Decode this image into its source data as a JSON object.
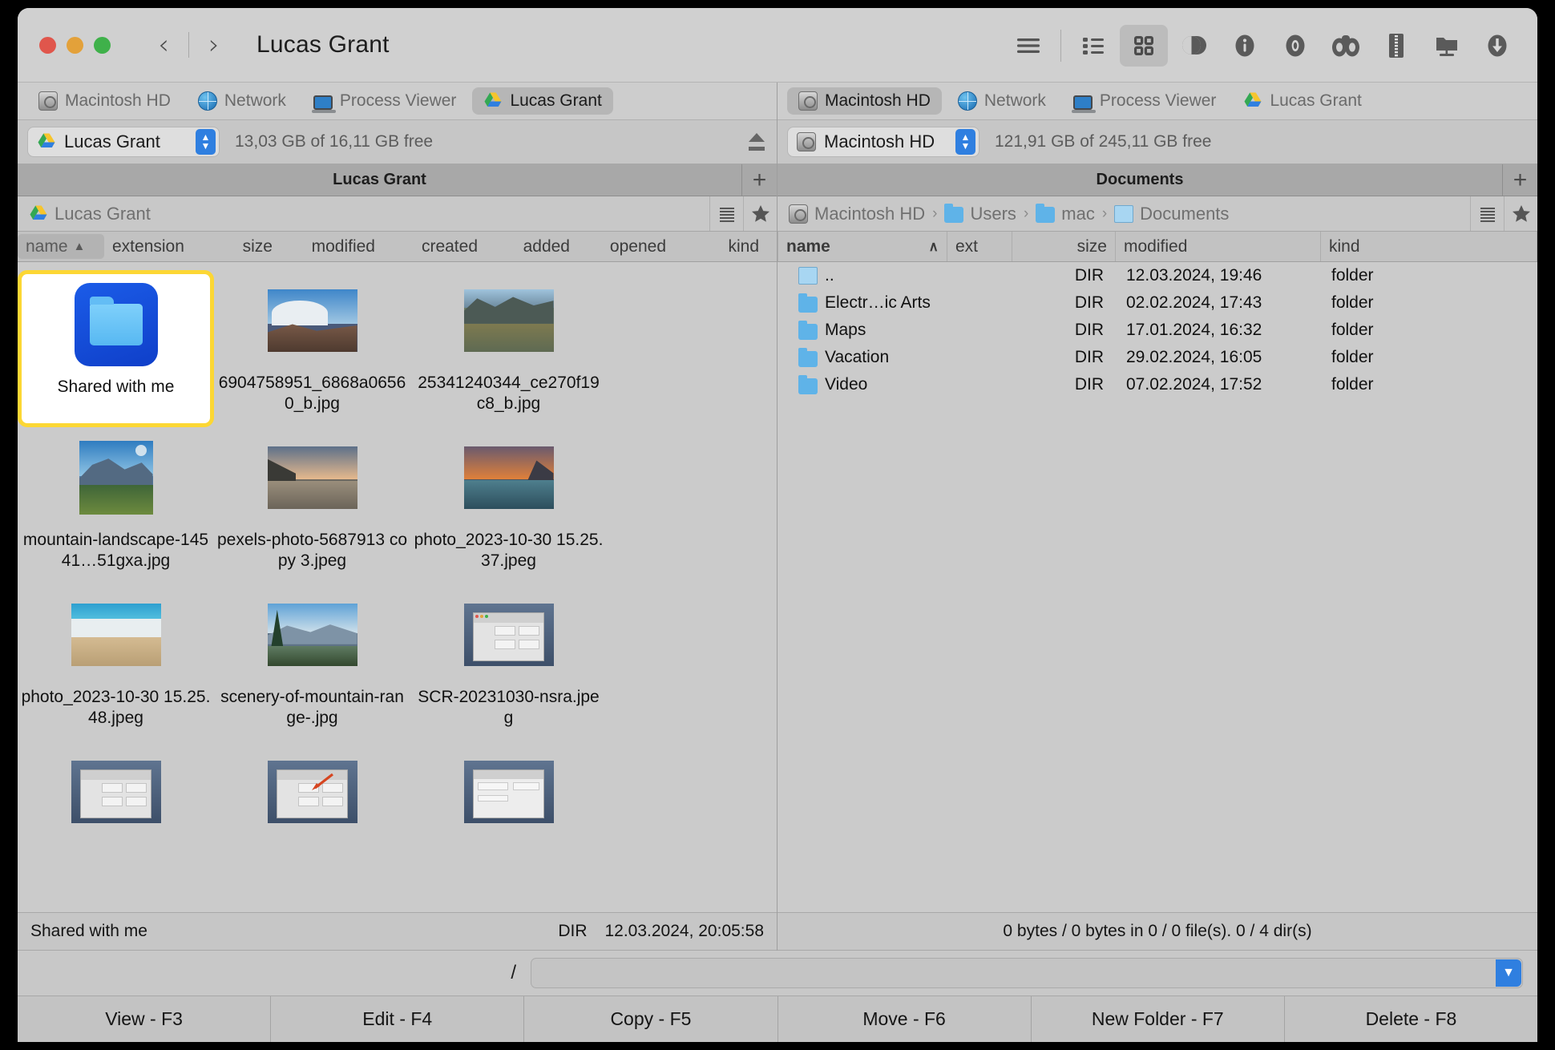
{
  "window": {
    "title": "Lucas Grant",
    "traffic": [
      "close",
      "minimize",
      "zoom"
    ],
    "nav_back": "‹",
    "nav_forward": "›"
  },
  "toolbar": {
    "items": [
      {
        "name": "menu-icon",
        "label": "Menu",
        "active": false
      },
      {
        "name": "list-view-icon",
        "label": "List View",
        "active": false
      },
      {
        "name": "grid-view-icon",
        "label": "Grid View",
        "active": true
      },
      {
        "name": "contrast-toggle-icon",
        "label": "Toggle",
        "active": false
      },
      {
        "name": "info-icon",
        "label": "Info",
        "active": false
      },
      {
        "name": "eye-icon",
        "label": "Preview",
        "active": false
      },
      {
        "name": "binoculars-icon",
        "label": "Find",
        "active": false
      },
      {
        "name": "zip-archive-icon",
        "label": "Compress",
        "active": false
      },
      {
        "name": "network-folder-icon",
        "label": "Connect",
        "active": false
      },
      {
        "name": "download-icon",
        "label": "Download",
        "active": false
      }
    ]
  },
  "left_pane": {
    "drive_tabs": [
      {
        "label": "Macintosh HD",
        "icon": "hd-icon",
        "selected": false
      },
      {
        "label": "Network",
        "icon": "globe-icon",
        "selected": false
      },
      {
        "label": "Process Viewer",
        "icon": "laptop-icon",
        "selected": false
      },
      {
        "label": "Lucas Grant",
        "icon": "gdrive-icon",
        "selected": true
      }
    ],
    "drive_selected": "Lucas Grant",
    "free_space": "13,03 GB of 16,11 GB free",
    "folder_tab": "Lucas Grant",
    "breadcrumb": [
      {
        "label": "Lucas Grant",
        "icon": "gdrive-icon"
      }
    ],
    "columns": [
      {
        "label": "name",
        "sorted": true,
        "arrow": "▲"
      },
      {
        "label": "extension",
        "sorted": false,
        "arrow": ""
      },
      {
        "label": "size",
        "sorted": false,
        "arrow": ""
      },
      {
        "label": "modified",
        "sorted": false,
        "arrow": ""
      },
      {
        "label": "created",
        "sorted": false,
        "arrow": ""
      },
      {
        "label": "added",
        "sorted": false,
        "arrow": ""
      },
      {
        "label": "opened",
        "sorted": false,
        "arrow": ""
      },
      {
        "label": "kind",
        "sorted": false,
        "arrow": ""
      }
    ],
    "items": [
      {
        "name": "Shared with me",
        "type": "folder",
        "selected": true
      },
      {
        "name": "6904758951_6868a06560_b.jpg",
        "type": "image",
        "scene": "denali",
        "selected": false
      },
      {
        "name": "25341240344_ce270f19c8_b.jpg",
        "type": "image",
        "scene": "lake",
        "selected": false
      },
      {
        "name": "mountain-landscape-14541…51gxa.jpg",
        "type": "image",
        "scene": "snowpeak",
        "selected": false
      },
      {
        "name": "pexels-photo-5687913 copy 3.jpeg",
        "type": "image",
        "scene": "coast",
        "selected": false
      },
      {
        "name": "photo_2023-10-30 15.25.37.jpeg",
        "type": "image",
        "scene": "sunset",
        "selected": false
      },
      {
        "name": "photo_2023-10-30 15.25.48.jpeg",
        "type": "image",
        "scene": "beach",
        "selected": false
      },
      {
        "name": "scenery-of-mountain-range-.jpg",
        "type": "image",
        "scene": "valley",
        "selected": false
      },
      {
        "name": "SCR-20231030-nsra.jpeg",
        "type": "image",
        "scene": "screenshot",
        "selected": false
      },
      {
        "name": "",
        "type": "image",
        "scene": "screenshot",
        "selected": false
      },
      {
        "name": "",
        "type": "image",
        "scene": "screenshot-arrow",
        "selected": false
      },
      {
        "name": "",
        "type": "image",
        "scene": "screenshot",
        "selected": false
      }
    ],
    "status": {
      "name": "Shared with me",
      "size": "DIR",
      "modified": "12.03.2024, 20:05:58"
    }
  },
  "right_pane": {
    "drive_tabs": [
      {
        "label": "Macintosh HD",
        "icon": "hd-icon",
        "selected": true
      },
      {
        "label": "Network",
        "icon": "globe-icon",
        "selected": false
      },
      {
        "label": "Process Viewer",
        "icon": "laptop-icon",
        "selected": false
      },
      {
        "label": "Lucas Grant",
        "icon": "gdrive-icon",
        "selected": false
      }
    ],
    "drive_selected": "Macintosh HD",
    "free_space": "121,91 GB of 245,11 GB free",
    "folder_tab": "Documents",
    "breadcrumb": [
      {
        "label": "Macintosh HD",
        "icon": "hd-icon"
      },
      {
        "label": "Users",
        "icon": "folder-icon"
      },
      {
        "label": "mac",
        "icon": "home-folder-icon"
      },
      {
        "label": "Documents",
        "icon": "doc-folder-icon"
      }
    ],
    "columns": [
      {
        "label": "name",
        "sorted": true,
        "arrow": "∧"
      },
      {
        "label": "ext",
        "sorted": false,
        "arrow": ""
      },
      {
        "label": "size",
        "sorted": false,
        "arrow": ""
      },
      {
        "label": "modified",
        "sorted": false,
        "arrow": ""
      },
      {
        "label": "kind",
        "sorted": false,
        "arrow": ""
      }
    ],
    "rows": [
      {
        "name": "..",
        "ext": "",
        "size": "DIR",
        "modified": "12.03.2024, 19:46",
        "kind": "folder",
        "icon": "parent-folder-icon"
      },
      {
        "name": "Electr…ic Arts",
        "ext": "",
        "size": "DIR",
        "modified": "02.02.2024, 17:43",
        "kind": "folder",
        "icon": "folder-icon"
      },
      {
        "name": "Maps",
        "ext": "",
        "size": "DIR",
        "modified": "17.01.2024, 16:32",
        "kind": "folder",
        "icon": "folder-icon"
      },
      {
        "name": "Vacation",
        "ext": "",
        "size": "DIR",
        "modified": "29.02.2024, 16:05",
        "kind": "folder",
        "icon": "folder-icon"
      },
      {
        "name": "Video",
        "ext": "",
        "size": "DIR",
        "modified": "07.02.2024, 17:52",
        "kind": "folder",
        "icon": "folder-icon"
      }
    ],
    "status": "0 bytes / 0 bytes in 0 / 0 file(s). 0 / 4 dir(s)"
  },
  "command_line": {
    "prompt": "/",
    "value": "",
    "placeholder": ""
  },
  "function_keys": [
    {
      "label": "View - F3"
    },
    {
      "label": "Edit - F4"
    },
    {
      "label": "Copy - F5"
    },
    {
      "label": "Move - F6"
    },
    {
      "label": "New Folder - F7"
    },
    {
      "label": "Delete - F8"
    }
  ],
  "colors": {
    "window_bg": "#c8c8c8",
    "accent_blue": "#2f7fe0",
    "selection_yellow": "#fcd734",
    "folder_blue": "#1b5ce8",
    "titlebar": "#d0d0d0"
  }
}
